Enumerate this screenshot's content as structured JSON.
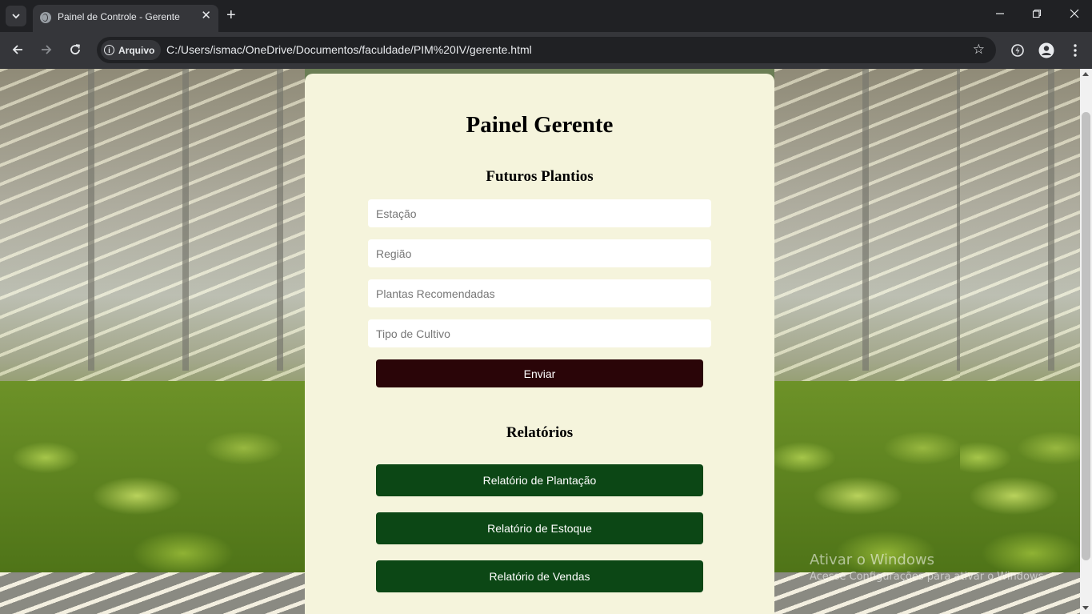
{
  "browser": {
    "tab_title": "Painel de Controle - Gerente",
    "new_tab_symbol": "+",
    "close_symbol": "✕",
    "security_chip": "Arquivo",
    "url": "C:/Users/ismac/OneDrive/Documentos/faculdade/PIM%20IV/gerente.html"
  },
  "page": {
    "title": "Painel Gerente",
    "planting_section": {
      "heading": "Futuros Plantios",
      "fields": [
        {
          "placeholder": "Estação",
          "value": ""
        },
        {
          "placeholder": "Região",
          "value": ""
        },
        {
          "placeholder": "Plantas Recomendadas",
          "value": ""
        },
        {
          "placeholder": "Tipo de Cultivo",
          "value": ""
        }
      ],
      "submit_label": "Enviar"
    },
    "reports_section": {
      "heading": "Relatórios",
      "buttons": [
        {
          "label": "Relatório de Plantação"
        },
        {
          "label": "Relatório de Estoque"
        },
        {
          "label": "Relatório de Vendas"
        }
      ]
    }
  },
  "watermark": {
    "title": "Ativar o Windows",
    "subtitle": "Acesse Configurações para ativar o Windows."
  },
  "colors": {
    "panel_bg": "#f5f4dc",
    "send_button": "#2a0508",
    "report_button": "#0c4715",
    "chrome_dark": "#202124",
    "chrome_toolbar": "#35363a"
  },
  "icons": [
    "tab-search-icon",
    "globe-icon",
    "close-icon",
    "plus-icon",
    "minimize-icon",
    "maximize-icon",
    "window-close-icon",
    "back-arrow-icon",
    "forward-arrow-icon",
    "reload-icon",
    "info-icon",
    "star-icon",
    "extensions-icon",
    "profile-icon",
    "menu-dots-icon"
  ]
}
